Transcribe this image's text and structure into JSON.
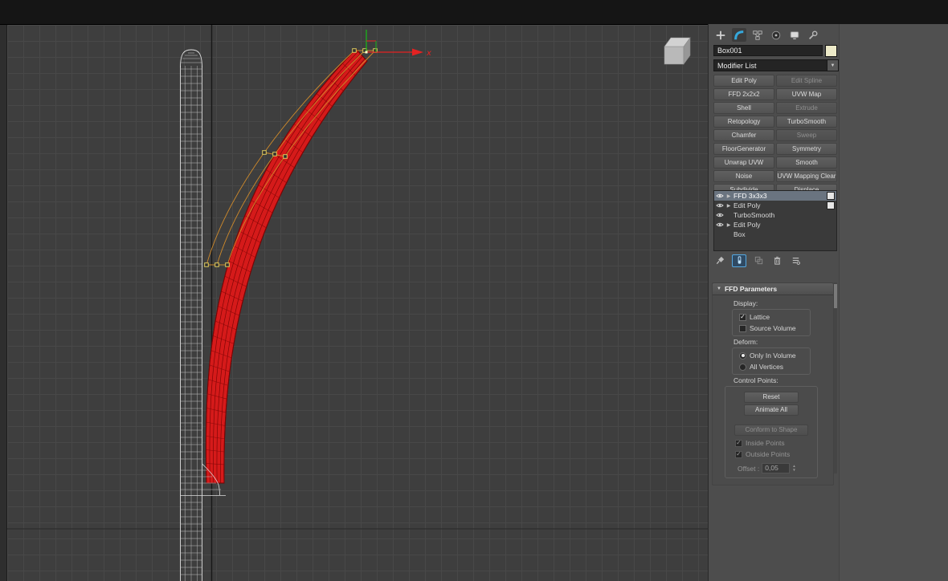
{
  "colors": {
    "selection_red": "#d51a1a",
    "tube_wire_dark": "#8f0909",
    "lattice_orange": "#cf8a2b",
    "control_point_yellow": "#ddca5e",
    "gizmo_x_red": "#e42222",
    "gizmo_y_green": "#1ab41a",
    "active_tab_blue": "#35a8dc",
    "wireframe_white": "#c2c2c2"
  },
  "viewport": {
    "gizmo_x_label": "x"
  },
  "icons": {
    "dropdown_arrow": "▼",
    "rollout_collapse": "▼",
    "expand_arrow": "▶",
    "check": "✓",
    "spinner_up": "▲",
    "spinner_down": "▼"
  },
  "command_panel": {
    "object_name": "Box001",
    "modifier_list_label": "Modifier List",
    "modifier_buttons": [
      {
        "label": "Edit Poly",
        "enabled": true
      },
      {
        "label": "Edit Spline",
        "enabled": false
      },
      {
        "label": "FFD 2x2x2",
        "enabled": true
      },
      {
        "label": "UVW Map",
        "enabled": true
      },
      {
        "label": "Shell",
        "enabled": true
      },
      {
        "label": "Extrude",
        "enabled": false
      },
      {
        "label": "Retopology",
        "enabled": true
      },
      {
        "label": "TurboSmooth",
        "enabled": true
      },
      {
        "label": "Chamfer",
        "enabled": true
      },
      {
        "label": "Sweep",
        "enabled": false
      },
      {
        "label": "FloorGenerator",
        "enabled": true
      },
      {
        "label": "Symmetry",
        "enabled": true
      },
      {
        "label": "Unwrap UVW",
        "enabled": true
      },
      {
        "label": "Smooth",
        "enabled": true
      },
      {
        "label": "Noise",
        "enabled": true
      },
      {
        "label": "UVW Mapping Clear",
        "enabled": true
      },
      {
        "label": "Subdivide",
        "enabled": true
      },
      {
        "label": "Displace",
        "enabled": true
      }
    ],
    "modifier_stack": [
      {
        "label": "FFD 3x3x3",
        "selected": true,
        "eye": true,
        "expandable": true,
        "badge": true
      },
      {
        "label": "Edit Poly",
        "selected": false,
        "eye": true,
        "expandable": true,
        "badge": true
      },
      {
        "label": "TurboSmooth",
        "selected": false,
        "eye": true,
        "expandable": false,
        "badge": false
      },
      {
        "label": "Edit Poly",
        "selected": false,
        "eye": true,
        "expandable": true,
        "badge": false
      },
      {
        "label": "Box",
        "selected": false,
        "eye": false,
        "expandable": false,
        "badge": false
      }
    ],
    "ffd_rollout": {
      "title": "FFD Parameters",
      "display_label": "Display:",
      "lattice_label": "Lattice",
      "source_volume_label": "Source Volume",
      "deform_label": "Deform:",
      "only_in_volume_label": "Only In Volume",
      "all_vertices_label": "All Vertices",
      "control_points_label": "Control Points:",
      "reset_label": "Reset",
      "animate_all_label": "Animate All",
      "conform_label": "Conform to Shape",
      "inside_points_label": "Inside Points",
      "outside_points_label": "Outside Points",
      "offset_label": "Offset :",
      "offset_value": "0,05"
    }
  }
}
